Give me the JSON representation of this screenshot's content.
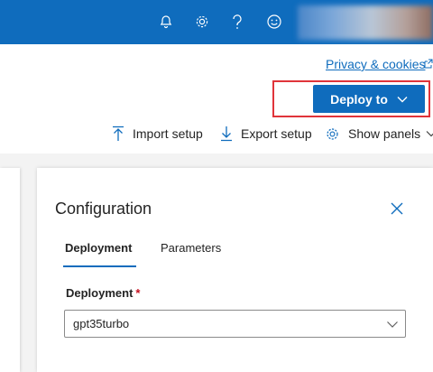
{
  "header": {
    "icons": [
      "bell-icon",
      "gear-icon",
      "help-icon",
      "feedback-smiley-icon"
    ]
  },
  "privacy_link": "Privacy & cookies",
  "deploy_button": {
    "label": "Deploy to"
  },
  "toolbar": {
    "import_label": "Import setup",
    "export_label": "Export setup",
    "panels_label": "Show panels"
  },
  "config_panel": {
    "title": "Configuration",
    "tabs": [
      {
        "label": "Deployment",
        "active": true
      },
      {
        "label": "Parameters",
        "active": false
      }
    ],
    "deployment_field": {
      "label": "Deployment",
      "required_mark": "*",
      "value": "gpt35turbo"
    }
  },
  "colors": {
    "brand": "#0f6cbd",
    "highlight_border": "#e0343a",
    "required": "#c50f1f"
  }
}
